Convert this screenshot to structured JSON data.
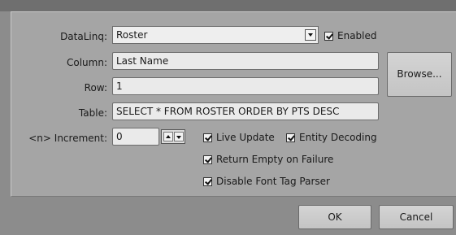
{
  "form": {
    "dataling_label": "DataLinq:",
    "dataling_value": "Roster",
    "enabled_label": "Enabled",
    "column_label": "Column:",
    "column_value": "Last Name",
    "row_label": "Row:",
    "row_value": "1",
    "table_label": "Table:",
    "table_value": "SELECT * FROM ROSTER ORDER BY PTS DESC",
    "increment_label": "<n> Increment:",
    "increment_value": "0",
    "browse_label": "Browse..."
  },
  "options": {
    "live_update": "Live Update",
    "entity_decoding": "Entity Decoding",
    "return_empty": "Return Empty on Failure",
    "disable_font_tag": "Disable Font Tag Parser"
  },
  "footer": {
    "ok_label": "OK",
    "cancel_label": "Cancel"
  },
  "icons": {
    "dropdown": "chevron-down-icon",
    "spin_up": "spin-up-icon",
    "spin_down": "spin-down-icon",
    "checkbox_checked": "checkbox-checked-icon"
  }
}
